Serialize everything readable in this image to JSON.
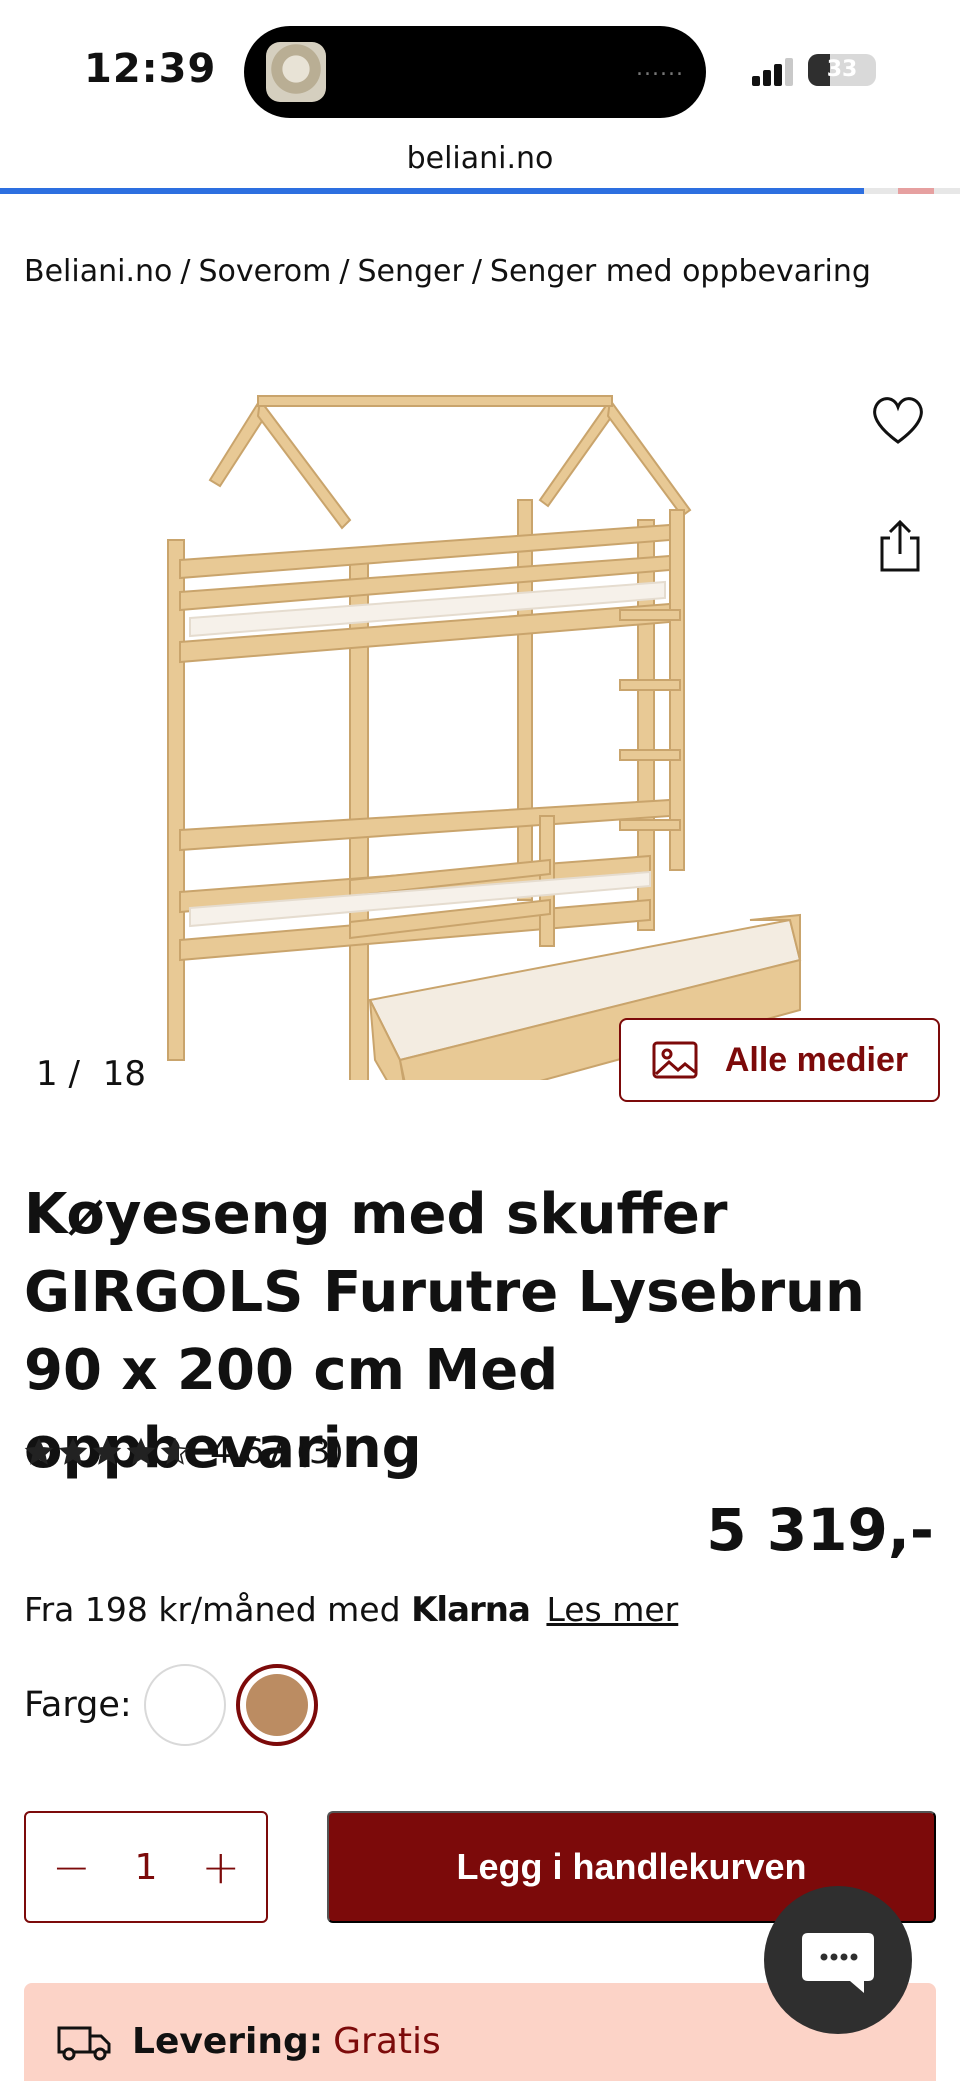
{
  "status_bar": {
    "time": "12:39",
    "battery": "33",
    "battery_level": 0.33,
    "island_dots": "......"
  },
  "browser": {
    "url": "beliani.no",
    "load_progress": 0.9
  },
  "breadcrumb": [
    "Beliani.no",
    "Soverom",
    "Senger",
    "Senger med oppbevaring"
  ],
  "breadcrumb_separator": "/",
  "gallery": {
    "counter_current": "1",
    "counter_sep": "/",
    "counter_total": "18",
    "all_media_label": "Alle medier"
  },
  "product": {
    "title": "Køyeseng med skuffer GIRGOLS Furutre Lysebrun 90 x 200 cm Med oppbevaring",
    "rating_value": "4,67",
    "rating_count": "(3)",
    "rating_stars": 4.67,
    "price": "5 319,-"
  },
  "klarna": {
    "prefix": "Fra 198 kr/måned med",
    "brand": "Klarna",
    "link": "Les mer"
  },
  "color": {
    "label": "Farge:",
    "options": [
      "#ffffff",
      "#bb8c62"
    ],
    "selected_index": 1
  },
  "quantity": {
    "value": "1",
    "minus": "−",
    "plus": "+"
  },
  "cart": {
    "label": "Legg i handlekurven"
  },
  "delivery": {
    "label": "Levering:",
    "value": "Gratis"
  },
  "colors": {
    "accent": "#7c0a0a",
    "delivery_bg": "#fcd3c7",
    "progress": "#2d6fe0"
  }
}
